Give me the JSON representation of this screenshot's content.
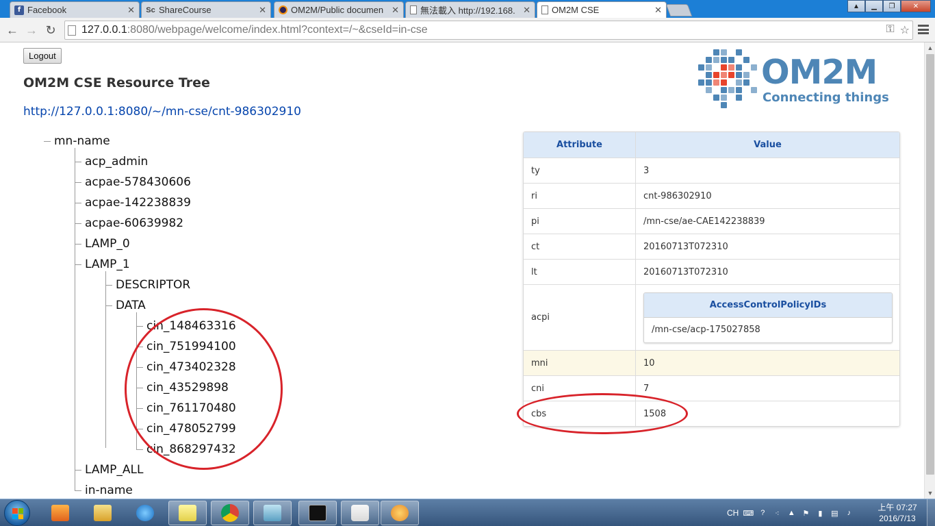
{
  "browser": {
    "tabs": [
      {
        "label": "Facebook",
        "icon": "facebook-icon"
      },
      {
        "label": "ShareCourse",
        "icon": "sharecourse-icon"
      },
      {
        "label": "OM2M/Public documen",
        "icon": "eclipse-icon"
      },
      {
        "label": "無法載入 http://192.168.",
        "icon": "page-icon"
      },
      {
        "label": "OM2M CSE",
        "icon": "page-icon",
        "active": true
      }
    ],
    "url_host": "127.0.0.1",
    "url_rest": ":8080/webpage/welcome/index.html?context=/~&cseId=in-cse"
  },
  "page": {
    "logout_label": "Logout",
    "title": "OM2M CSE Resource Tree",
    "resource_url": "http://127.0.0.1:8080/~/mn-cse/cnt-986302910",
    "logo": {
      "title": "OM2M",
      "subtitle": "Connecting things",
      "color": "#4e86b6",
      "accent": "#e8452c"
    }
  },
  "tree": {
    "root": "mn-name",
    "children": [
      "acp_admin",
      "acpae-578430606",
      "acpae-142238839",
      "acpae-60639982",
      "LAMP_0",
      "LAMP_1",
      "LAMP_ALL",
      "in-name"
    ],
    "lamp1_children": [
      "DESCRIPTOR",
      "DATA"
    ],
    "data_children": [
      "cin_148463316",
      "cin_751994100",
      "cin_473402328",
      "cin_43529898",
      "cin_761170480",
      "cin_478052799",
      "cin_868297432"
    ]
  },
  "attributes": {
    "header": {
      "attribute": "Attribute",
      "value": "Value"
    },
    "rows": [
      {
        "name": "ty",
        "value": "3"
      },
      {
        "name": "ri",
        "value": "cnt-986302910"
      },
      {
        "name": "pi",
        "value": "/mn-cse/ae-CAE142238839"
      },
      {
        "name": "ct",
        "value": "20160713T072310"
      },
      {
        "name": "lt",
        "value": "20160713T072310"
      },
      {
        "name": "acpi",
        "nested_header": "AccessControlPolicyIDs",
        "nested_value": "/mn-cse/acp-175027858"
      },
      {
        "name": "mni",
        "value": "10"
      },
      {
        "name": "cni",
        "value": "7"
      },
      {
        "name": "cbs",
        "value": "1508"
      }
    ]
  },
  "taskbar": {
    "tray_lang": "CH",
    "clock_time": "上午 07:27",
    "clock_date": "2016/7/13"
  },
  "colors": {
    "annotation": "#d8232a",
    "link": "#0645ad",
    "table_header": "#dce9f8"
  }
}
